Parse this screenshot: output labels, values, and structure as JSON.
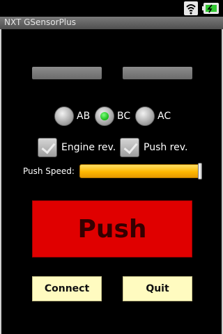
{
  "app": {
    "title": "NXT GSensorPlus"
  },
  "status_icons": [
    "wifi-icon",
    "battery-icon"
  ],
  "ports": {
    "options": [
      {
        "label": "AB",
        "checked": false
      },
      {
        "label": "BC",
        "checked": true
      },
      {
        "label": "AC",
        "checked": false
      }
    ]
  },
  "options": {
    "engine_rev": {
      "label": "Engine rev.",
      "checked": true
    },
    "push_rev": {
      "label": "Push rev.",
      "checked": true
    }
  },
  "speed": {
    "label": "Push Speed:",
    "value_fraction": 0.99
  },
  "push": {
    "label": "Push"
  },
  "actions": {
    "connect_label": "Connect",
    "quit_label": "Quit"
  },
  "colors": {
    "push_button": "#e00000",
    "action_button": "#fffbc0",
    "slider": "#ffb800",
    "selected_radio": "#18b818"
  }
}
